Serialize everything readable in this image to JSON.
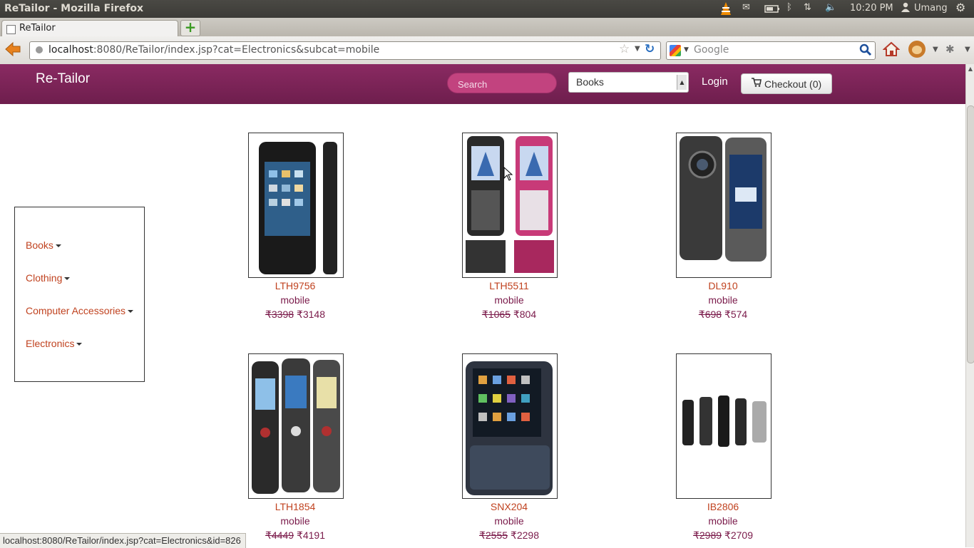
{
  "os": {
    "window_title": "ReTailor - Mozilla Firefox",
    "time": "10:20 PM",
    "user": "Umang"
  },
  "browser": {
    "tab_title": "ReTailor",
    "url_host": "localhost",
    "url_rest": ":8080/ReTailor/index.jsp?cat=Electronics&subcat=mobile",
    "search_placeholder": "Google",
    "status_url": "localhost:8080/ReTailor/index.jsp?cat=Electronics&id=826"
  },
  "header": {
    "brand": "Re-Tailor",
    "search_placeholder": "Search",
    "category_selected": "Books",
    "login_label": "Login",
    "checkout_label": "Checkout (0)"
  },
  "sidebar": {
    "items": [
      {
        "label": "Books"
      },
      {
        "label": "Clothing"
      },
      {
        "label": "Computer Accessories"
      },
      {
        "label": "Electronics"
      }
    ]
  },
  "products": [
    {
      "name": "LTH9756",
      "category": "mobile",
      "old_price": "₹3398",
      "price": "₹3148"
    },
    {
      "name": "LTH5511",
      "category": "mobile",
      "old_price": "₹1065",
      "price": "₹804"
    },
    {
      "name": "DL910",
      "category": "mobile",
      "old_price": "₹698",
      "price": "₹574"
    },
    {
      "name": "LTH1854",
      "category": "mobile",
      "old_price": "₹4449",
      "price": "₹4191"
    },
    {
      "name": "SNX204",
      "category": "mobile",
      "old_price": "₹2555",
      "price": "₹2298"
    },
    {
      "name": "IB2806",
      "category": "mobile",
      "old_price": "₹2989",
      "price": "₹2709"
    }
  ],
  "colors": {
    "header_bg": "#7a2456",
    "link": "#c0421f",
    "text_accent": "#7a1a4a"
  }
}
